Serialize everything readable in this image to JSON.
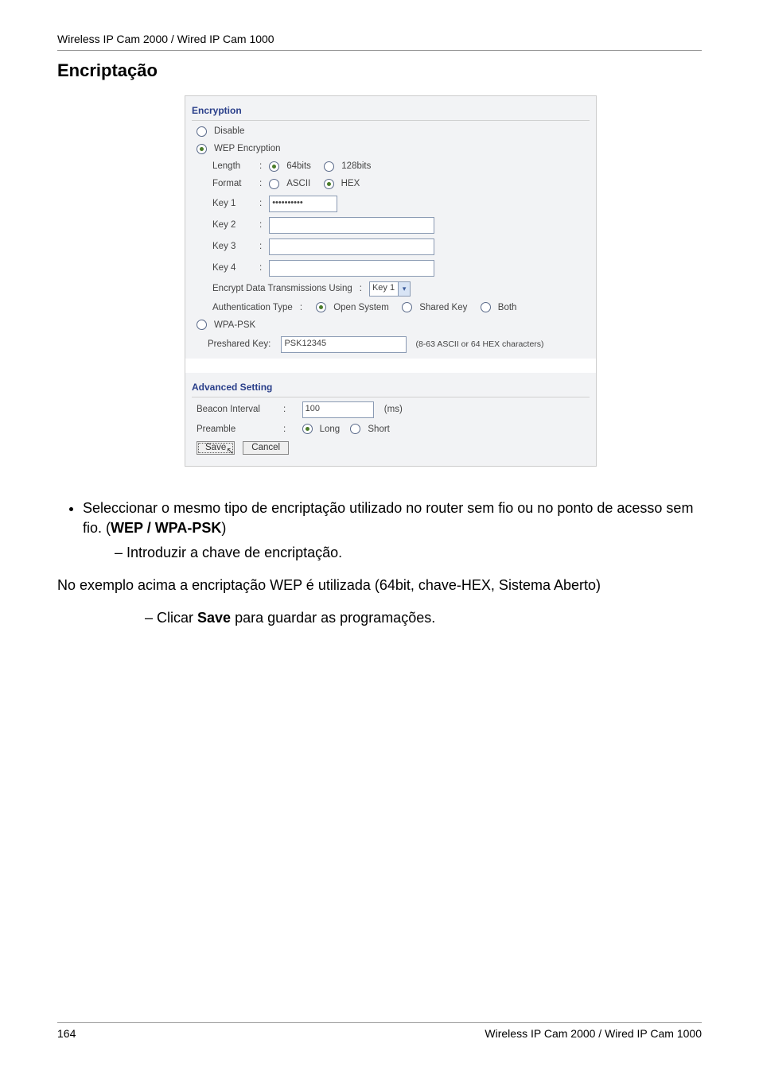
{
  "header": {
    "product": "Wireless IP Cam 2000 / Wired IP Cam 1000"
  },
  "section_title": "Encriptação",
  "panel": {
    "encryption_title": "Encryption",
    "disable": "Disable",
    "wep_label": "WEP Encryption",
    "length_label": "Length",
    "length_64": "64bits",
    "length_128": "128bits",
    "format_label": "Format",
    "format_ascii": "ASCII",
    "format_hex": "HEX",
    "key1": "Key 1",
    "key2": "Key 2",
    "key3": "Key 3",
    "key4": "Key 4",
    "key1_value": "••••••••••",
    "encrypt_using": "Encrypt Data Transmissions Using",
    "encrypt_key_selected": "Key 1",
    "auth_type": "Authentication Type",
    "auth_open": "Open System",
    "auth_shared": "Shared Key",
    "auth_both": "Both",
    "wpa_label": "WPA-PSK",
    "psk_label": "Preshared Key:",
    "psk_value": "PSK12345",
    "psk_hint": "(8-63 ASCII or 64 HEX characters)",
    "advanced_title": "Advanced Setting",
    "beacon_label": "Beacon Interval",
    "beacon_value": "100",
    "beacon_unit": "(ms)",
    "preamble_label": "Preamble",
    "preamble_long": "Long",
    "preamble_short": "Short",
    "save_btn": "Save",
    "cancel_btn": "Cancel"
  },
  "body": {
    "bullet1_a": "Seleccionar o mesmo tipo de encriptação utilizado no router sem fio ou no ponto de acesso sem fio. (",
    "bullet1_bold": "WEP / WPA-PSK",
    "bullet1_b": ")",
    "sub1": "Introduzir a chave de encriptação.",
    "para1": "No exemplo acima a encriptação WEP é utilizada (64bit, chave-HEX, Sistema Aberto)",
    "sub2_a": "Clicar ",
    "sub2_bold": "Save",
    "sub2_b": " para guardar as programações."
  },
  "footer": {
    "page": "164",
    "product": "Wireless IP Cam 2000 / Wired IP Cam 1000"
  }
}
